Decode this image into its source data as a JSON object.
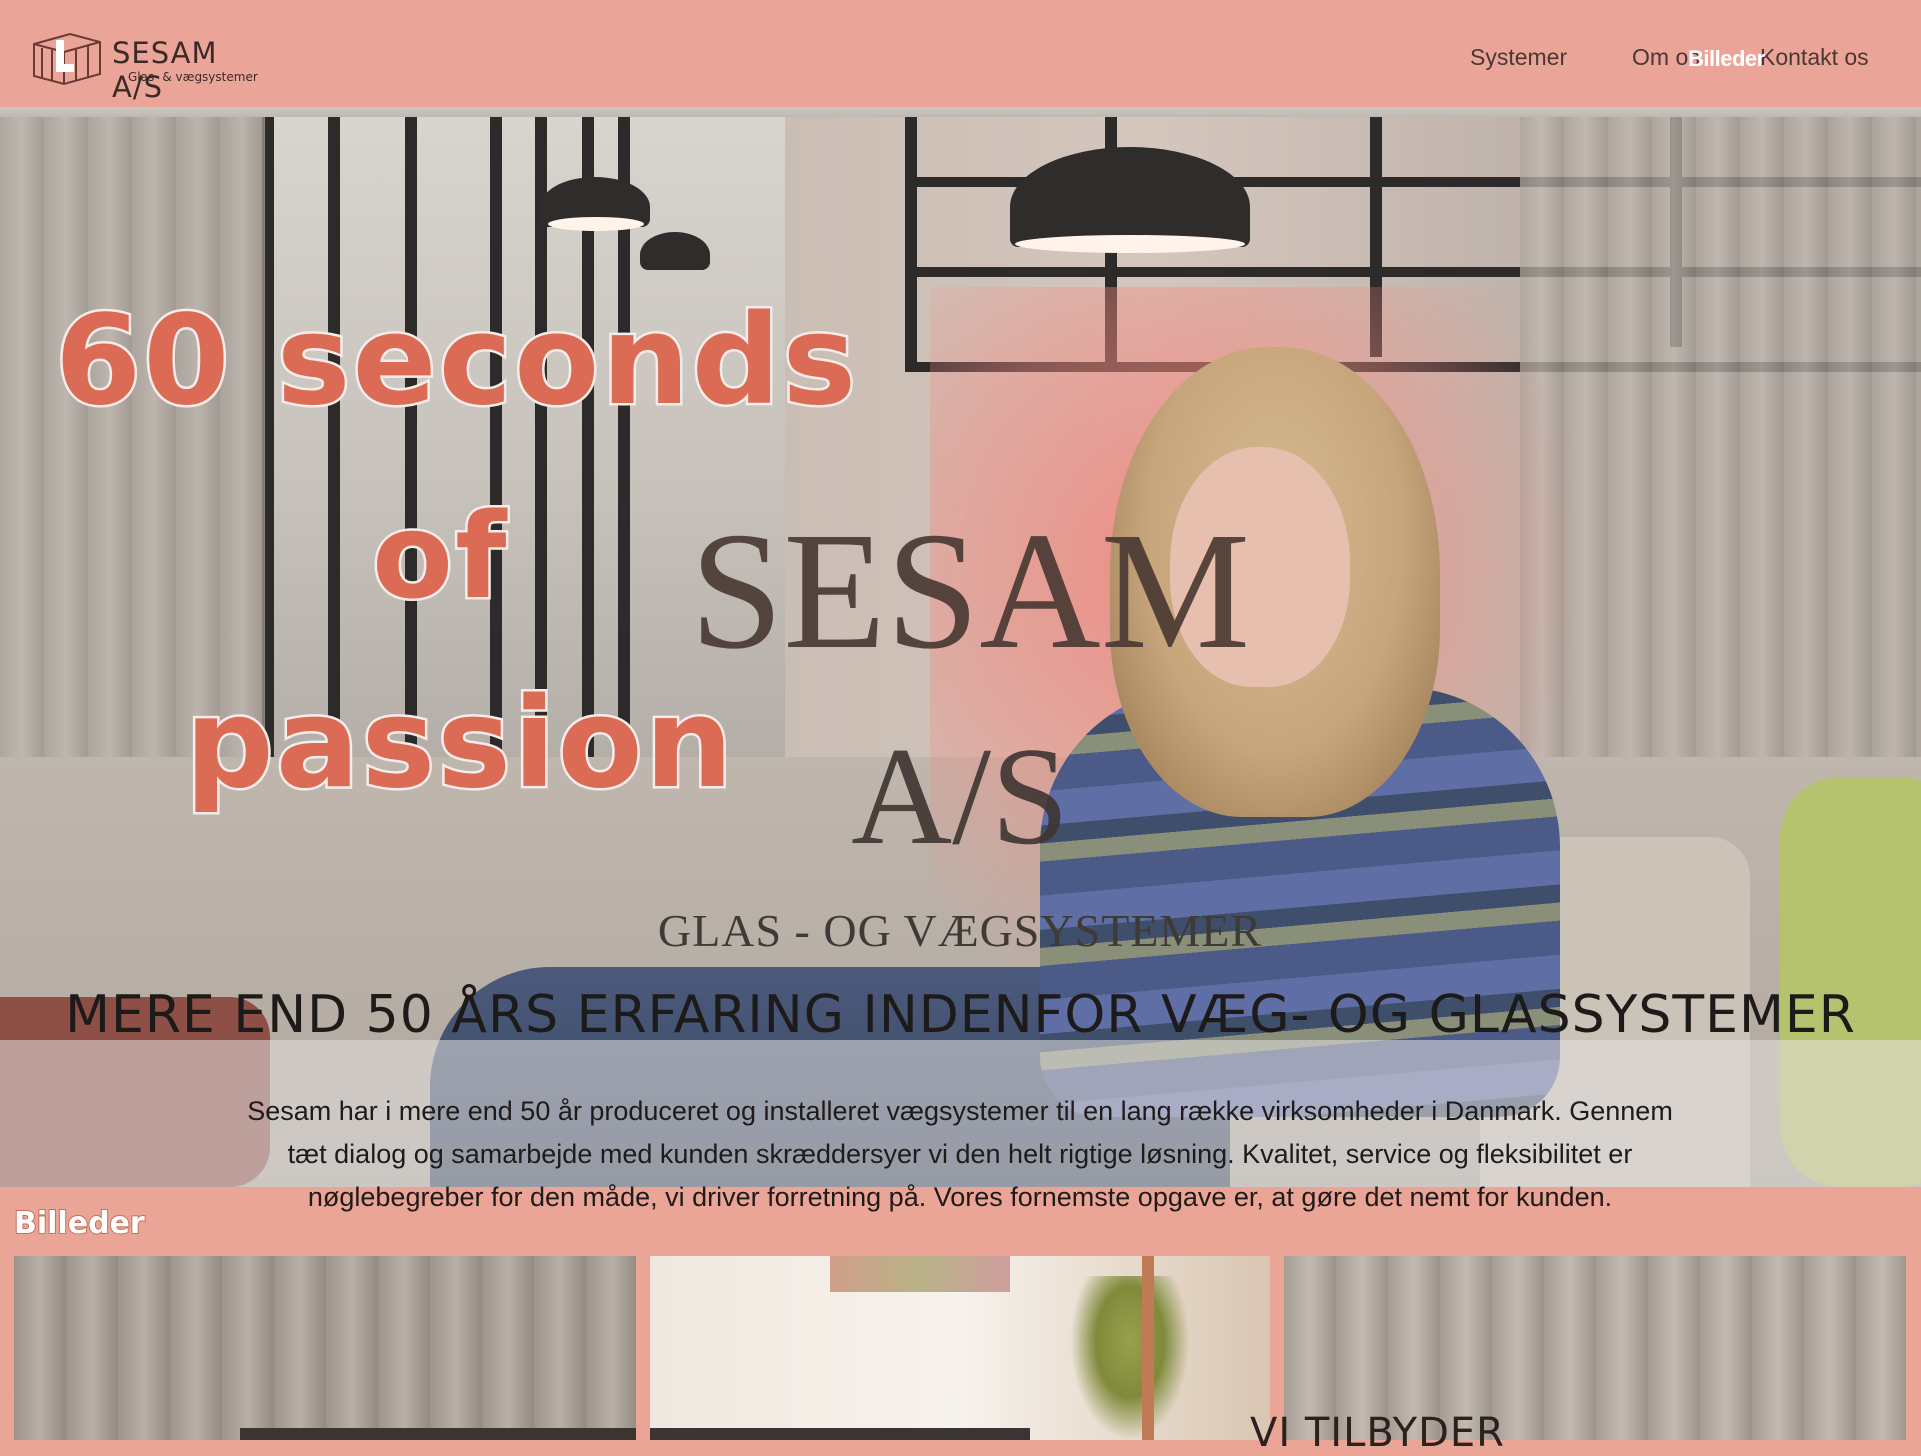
{
  "header": {
    "logo_title": "SESAM A/S",
    "logo_subtitle": "Glas- & vægsystemer",
    "nav": {
      "systemer": "Systemer",
      "om_os": "Om os",
      "billeder": "Billeder",
      "kontakt": "Kontakt os"
    }
  },
  "hero": {
    "promo_line1": "60 seconds",
    "promo_line2": "of",
    "promo_line3": "passion",
    "brand_title": "SESAM",
    "brand_suffix": "A/S",
    "brand_subtitle": "GLAS - OG VÆGSYSTEMER",
    "headline": "MERE END 50 ÅRS ERFARING INDENFOR VÆG- OG GLASSYSTEMER",
    "body": "Sesam har i mere end 50 år produceret og installeret vægsystemer til en lang række virksomheder i Danmark. Gennem tæt dialog og samarbejde med kunden skræddersyer vi den helt rigtige løsning. Kvalitet, service og fleksibilitet er nøglebegreber for den måde, vi driver forretning på. Vores fornemste opgave er, at gøre det nemt for kunden."
  },
  "gallery": {
    "label": "Billeder"
  },
  "services": {
    "title": "VI TILBYDER"
  },
  "colors": {
    "header_bg": "#eba598",
    "promo_text": "#dc6b55",
    "brand_text": "#4b3a34"
  }
}
